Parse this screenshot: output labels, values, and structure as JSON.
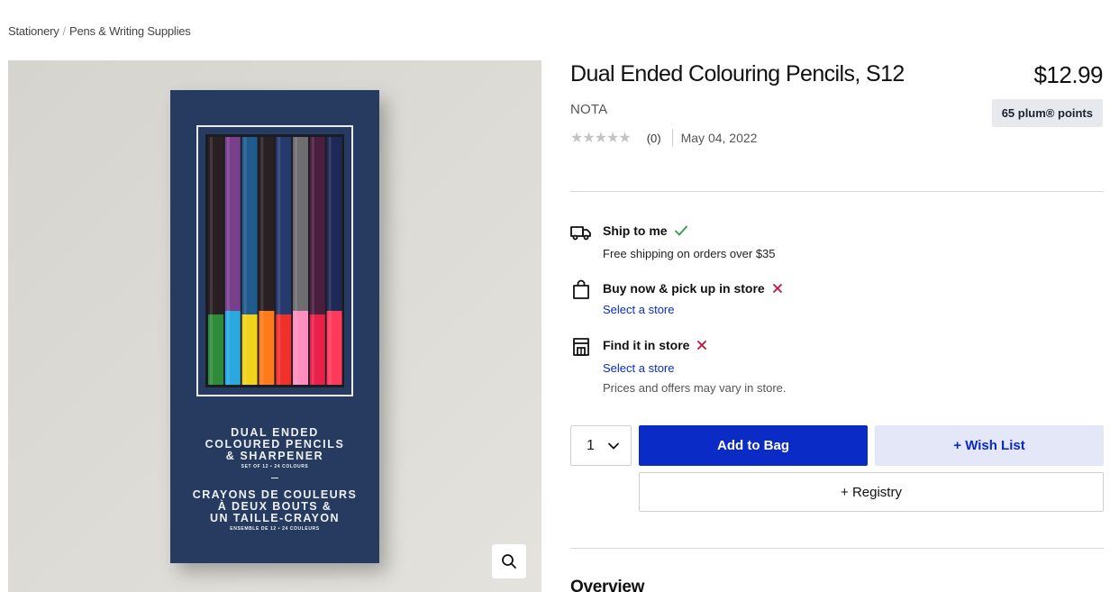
{
  "breadcrumb": {
    "items": [
      "Stationery",
      "Pens & Writing Supplies"
    ],
    "separator": "/"
  },
  "product": {
    "title": "Dual Ended Colouring Pencils, S12",
    "price": "$12.99",
    "points": "65 plum® points",
    "brand": "NOTA",
    "rating_count": "(0)",
    "date": "May 04, 2022",
    "stars": "★★★★★"
  },
  "image": {
    "box_text": {
      "en_line1": "DUAL ENDED",
      "en_line2": "COLOURED PENCILS",
      "en_line3": "& SHARPENER",
      "en_sub": "SET OF 12 • 24 COLOURS",
      "fr_line1": "CRAYONS DE COULEURS",
      "fr_line2": "À DEUX BOUTS &",
      "fr_line3": "UN TAILLE-CRAYON",
      "fr_sub": "ENSEMBLE DE 12 • 24 COULEURS"
    },
    "pencil_top_colors": [
      "#2a1f22",
      "#7a3f8c",
      "#1f5b8c",
      "#2a1f22",
      "#273a6e",
      "#6e6e72",
      "#4a1f3e",
      "#1e2a55"
    ],
    "pencil_bottom_colors": [
      "#2e8b3a",
      "#2aa9e0",
      "#f2d21a",
      "#ff7a1a",
      "#f0302a",
      "#ff8fbf",
      "#e8204a",
      "#ff3a5a"
    ],
    "zoom_icon": "search-icon"
  },
  "fulfillment": {
    "ship": {
      "icon": "truck-icon",
      "title": "Ship to me",
      "status": "available",
      "detail": "Free shipping on orders over $35"
    },
    "pickup": {
      "icon": "shopping-bag-icon",
      "title": "Buy now & pick up in store",
      "status": "unavailable",
      "link": "Select a store"
    },
    "find": {
      "icon": "store-icon",
      "title": "Find it in store",
      "status": "unavailable",
      "link": "Select a store",
      "note": "Prices and offers may vary in store."
    }
  },
  "actions": {
    "quantity": "1",
    "add_to_bag": "Add to Bag",
    "wish_list": "+ Wish List",
    "registry": "+ Registry"
  },
  "sections": {
    "overview": "Overview"
  },
  "colors": {
    "primary": "#0a2bc6",
    "wish_bg": "#e3e7f7",
    "check": "#2e9a4a",
    "cross": "#c4123c",
    "box_navy": "#283a5e"
  }
}
